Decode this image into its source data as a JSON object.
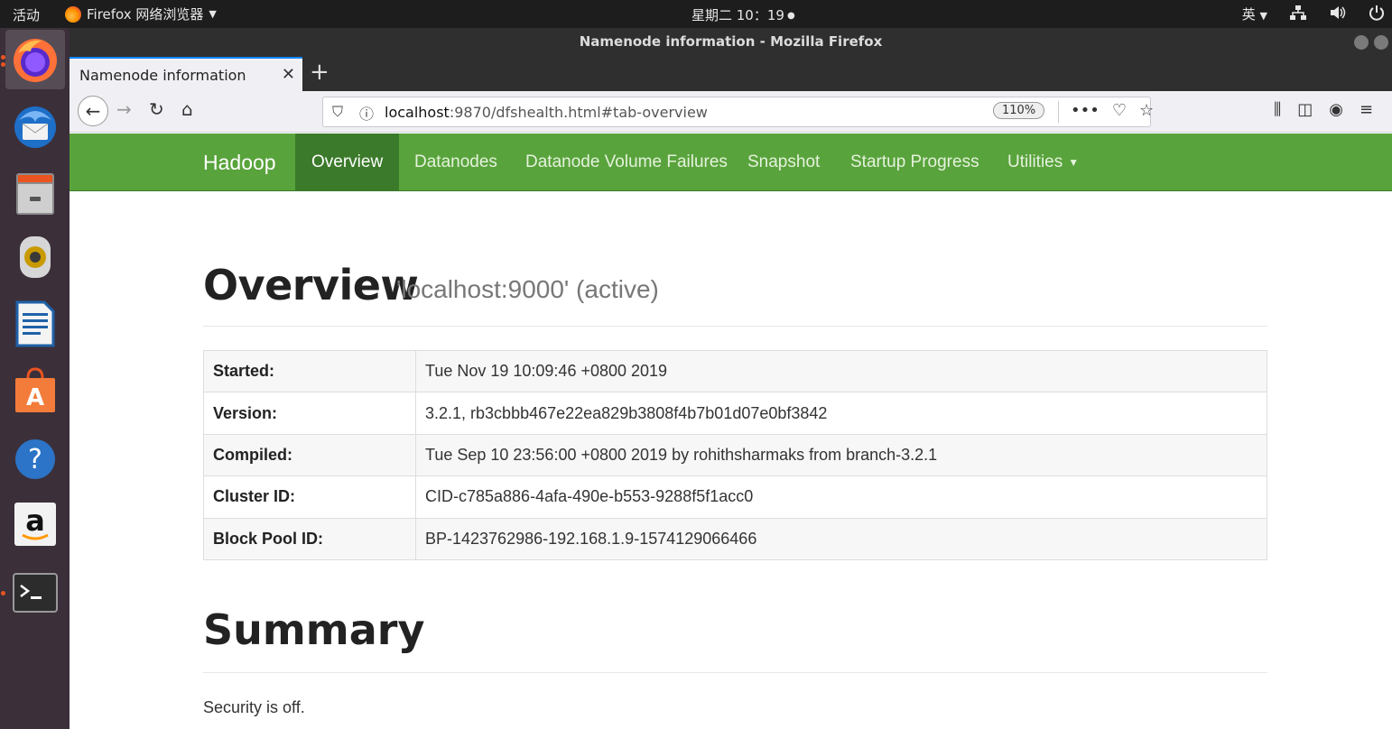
{
  "topbar": {
    "activities": "活动",
    "app_menu": "Firefox 网络浏览器",
    "clock": "星期二 10：19",
    "lang": "英"
  },
  "window": {
    "title": "Namenode information - Mozilla Firefox"
  },
  "tabs": [
    {
      "label": "Namenode information"
    }
  ],
  "toolbar": {
    "url_host": "localhost",
    "url_rest": ":9870/dfshealth.html#tab-overview",
    "zoom": "110%"
  },
  "hadoop_nav": {
    "brand": "Hadoop",
    "items": [
      {
        "label": "Overview"
      },
      {
        "label": "Datanodes"
      },
      {
        "label": "Datanode Volume Failures"
      },
      {
        "label": "Snapshot"
      },
      {
        "label": "Startup Progress"
      },
      {
        "label": "Utilities"
      }
    ]
  },
  "overview": {
    "title": "Overview",
    "subtitle": "'localhost:9000' (active)",
    "rows": [
      {
        "key": "Started:",
        "value": "Tue Nov 19 10:09:46 +0800 2019"
      },
      {
        "key": "Version:",
        "value": "3.2.1, rb3cbbb467e22ea829b3808f4b7b01d07e0bf3842"
      },
      {
        "key": "Compiled:",
        "value": "Tue Sep 10 23:56:00 +0800 2019 by rohithsharmaks from branch-3.2.1"
      },
      {
        "key": "Cluster ID:",
        "value": "CID-c785a886-4afa-490e-b553-9288f5f1acc0"
      },
      {
        "key": "Block Pool ID:",
        "value": "BP-1423762986-192.168.1.9-1574129066466"
      }
    ]
  },
  "summary": {
    "title": "Summary",
    "security": "Security is off."
  },
  "colors": {
    "hadoop_green": "#59a33c",
    "hadoop_green_active": "#3b7a2a",
    "dock_bg": "#3b2f3a"
  }
}
